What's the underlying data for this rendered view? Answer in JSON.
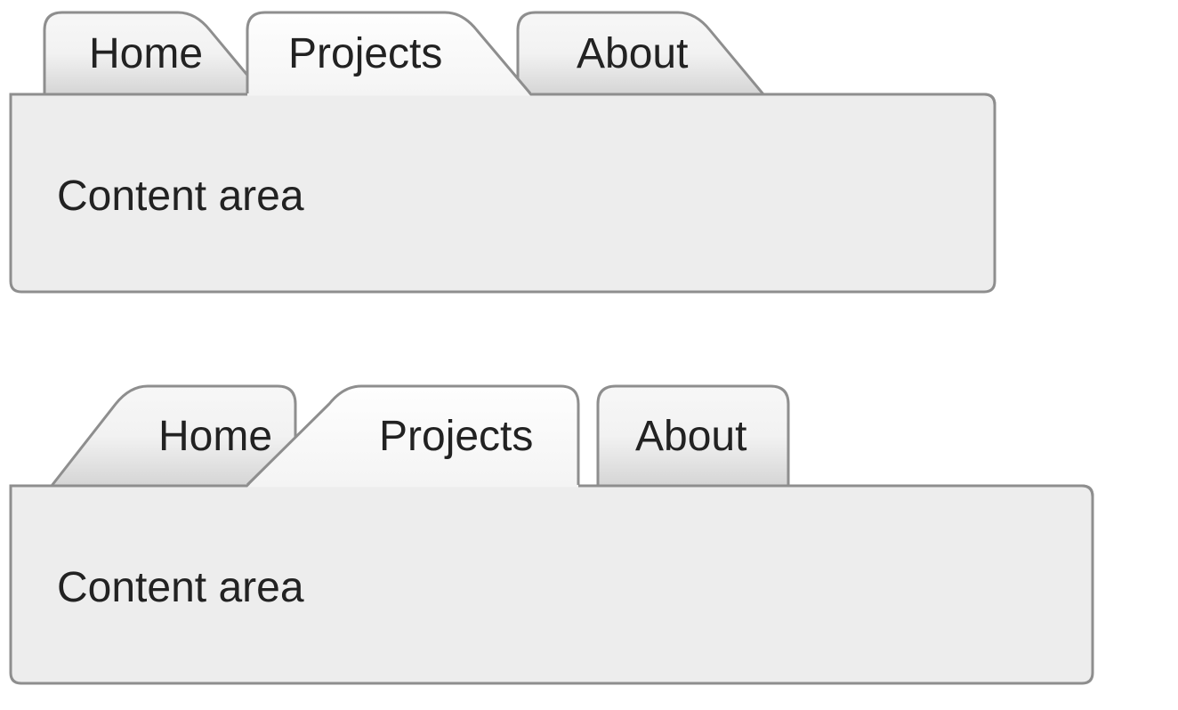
{
  "examples": [
    {
      "tabs": [
        {
          "name": "home",
          "label": "Home",
          "active": false
        },
        {
          "name": "projects",
          "label": "Projects",
          "active": true
        },
        {
          "name": "about",
          "label": "About",
          "active": false
        }
      ],
      "content_label": "Content area"
    },
    {
      "tabs": [
        {
          "name": "home",
          "label": "Home",
          "active": false
        },
        {
          "name": "projects",
          "label": "Projects",
          "active": true
        },
        {
          "name": "about",
          "label": "About",
          "active": false
        }
      ],
      "content_label": "Content area"
    }
  ],
  "colors": {
    "border": "#8e8e8e",
    "content_fill": "#ededed",
    "tab_active_top": "#fefefe",
    "tab_active_bot": "#f6f6f6",
    "tab_inactive_top": "#f7f7f7",
    "tab_inactive_bot": "#d5d5d5"
  }
}
